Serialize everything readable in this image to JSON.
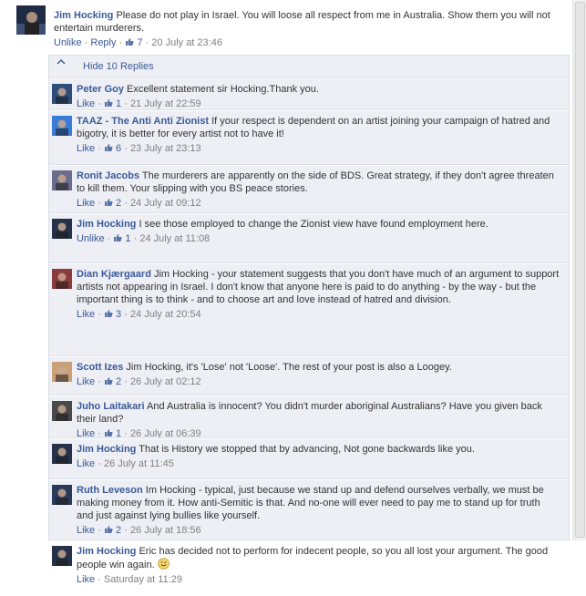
{
  "main_comment": {
    "author": "Jim Hocking",
    "text": "Please do not play in Israel. You will loose all respect from me in Australia. Show them you will not entertain murderers.",
    "like_action": "Unlike",
    "reply_action": "Reply",
    "likes": "7",
    "timestamp": "20 July at 23:46",
    "avatar_icon": "user-avatar-photo"
  },
  "replies_toggle": {
    "label": "Hide 10 Replies",
    "icon": "chevron-up-icon"
  },
  "replies": [
    {
      "author": "Peter Goy",
      "text": "Excellent statement sir Hocking.Thank you.",
      "like_action": "Like",
      "likes": "1",
      "timestamp": "21 July at 22:59",
      "avatar_color": "#2e4d7a"
    },
    {
      "author": "TAAZ - The Anti Anti Zionist",
      "text": "If your respect is dependent on an artist joining your campaign of hatred and bigotry, it is better for every artist not to have it!",
      "like_action": "Like",
      "likes": "6",
      "timestamp": "23 July at 23:13",
      "avatar_color": "#3a7bd5"
    },
    {
      "author": "Ronit Jacobs",
      "text": "The murderers are apparently on the side of BDS. Great strategy, if they don't agree threaten to kill them. Your slipping with you BS peace stories.",
      "like_action": "Like",
      "likes": "2",
      "timestamp": "24 July at 09:12",
      "avatar_color": "#6b6b8a"
    },
    {
      "author": "Jim Hocking",
      "text": "I see those employed to change the Zionist view have found employment here.",
      "like_action": "Unlike",
      "likes": "1",
      "timestamp": "24 July at 11:08",
      "avatar_color": "#26324a"
    },
    {
      "author": "Dian Kjærgaard",
      "text": "Jim Hocking - your statement suggests that you don't have much of an argument to support artists not appearing in Israel. I don't know that anyone here is paid to do anything - by the way - but the important thing is to think - and to choose art and love instead of hatred and division.",
      "like_action": "Like",
      "likes": "3",
      "timestamp": "24 July at 20:54",
      "avatar_color": "#8a3b3b"
    },
    {
      "author": "Scott Izes",
      "text": "Jim Hocking, it's 'Lose' not 'Loose'. The rest of your post is also a Loogey.",
      "like_action": "Like",
      "likes": "2",
      "timestamp": "26 July at 02:12",
      "avatar_color": "#c9a07a"
    },
    {
      "author": "Juho Laitakari",
      "text": "And Australia is innocent? You didn't murder aboriginal Australians? Have you given back their land?",
      "like_action": "Like",
      "likes": "1",
      "timestamp": "26 July at 06:39",
      "avatar_color": "#4a4a4a"
    },
    {
      "author": "Jim Hocking",
      "text": "That is History we stopped that by advancing, Not gone backwards like you.",
      "like_action": "Like",
      "likes": "",
      "timestamp": "26 July at 11:45",
      "avatar_color": "#26324a"
    },
    {
      "author": "Ruth Leveson",
      "text": "Im Hocking - typical, just because we stand up and defend ourselves verbally, we must be making money from it. How anti-Semitic is that. And no-one will ever need to pay me to stand up for truth and just against lying bullies like yourself.",
      "like_action": "Like",
      "likes": "2",
      "timestamp": "26 July at 18:56",
      "avatar_color": "#2a3a5a"
    },
    {
      "author": "Jim Hocking",
      "text": "Eric has decided not to perform for indecent people, so you all lost your argument. The good people win again.",
      "like_action": "Like",
      "likes": "",
      "timestamp": "Saturday at 11:29",
      "avatar_color": "#26324a",
      "emoticon": "smiley-icon"
    }
  ],
  "colors": {
    "link": "#3b5998",
    "meta": "#808080",
    "reply_bg": "#edeff4"
  }
}
